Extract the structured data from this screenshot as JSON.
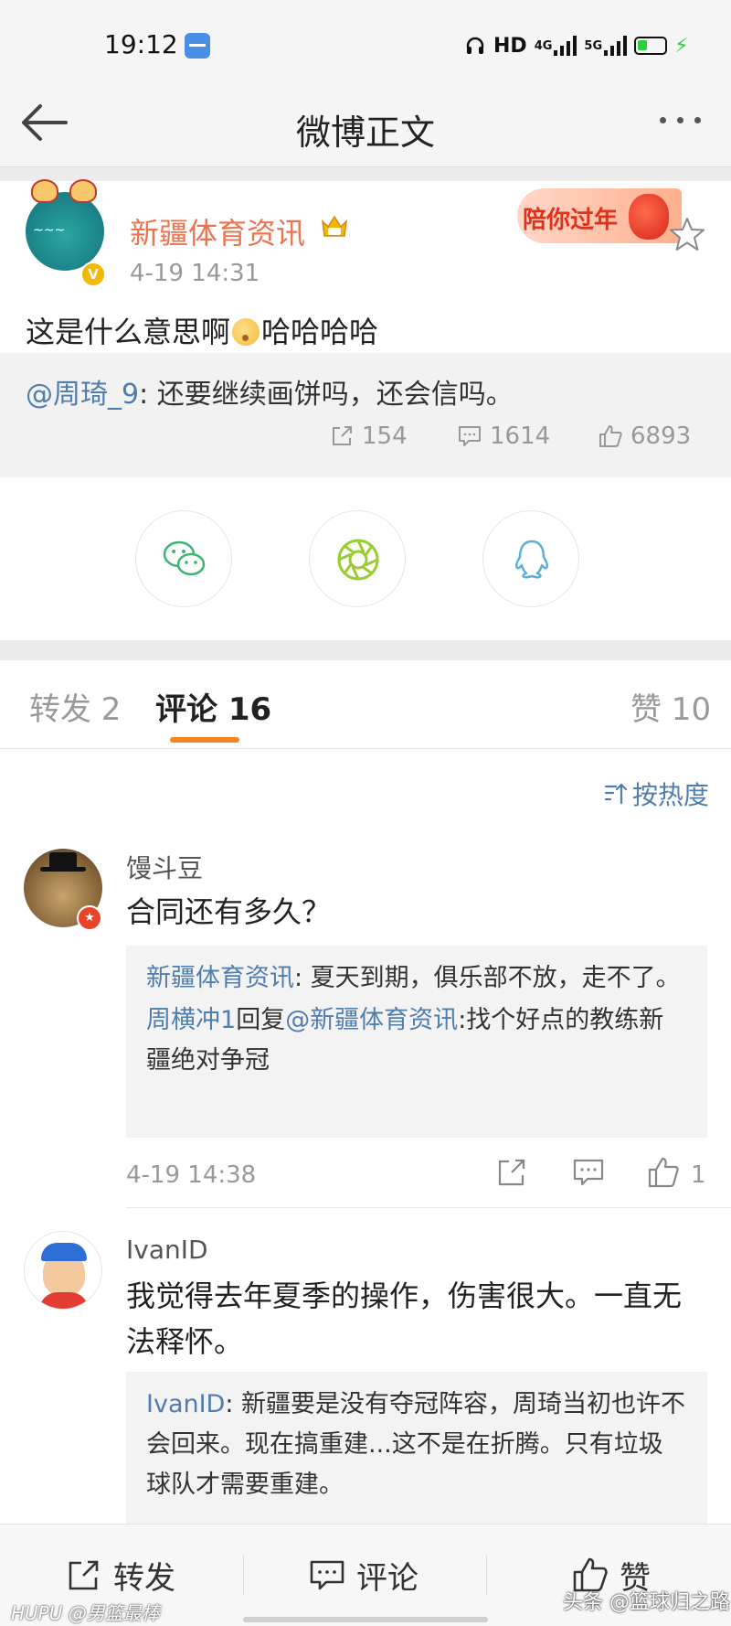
{
  "status_bar": {
    "time": "19:12",
    "hd": "HD",
    "net1": "4G",
    "net2": "5G"
  },
  "nav": {
    "title": "微博正文"
  },
  "post": {
    "author": "新疆体育资讯",
    "time": "4-19 14:31",
    "festival_badge": "陪你过年",
    "text_before_emoji": "这是什么意思啊",
    "text_after_emoji": "哈哈哈哈",
    "repost": {
      "mention": "@周琦_9",
      "text": ": 还要继续画饼吗，还会信吗。"
    },
    "stats": {
      "reposts": "154",
      "comments": "1614",
      "likes": "6893"
    }
  },
  "tabs": {
    "repost": "转发 2",
    "comment": "评论 16",
    "like": "赞 10"
  },
  "sort_label": "按热度",
  "comments": [
    {
      "name": "馒斗豆",
      "text": "合同还有多久？",
      "replies": [
        {
          "author": "新疆体育资讯",
          "text": ": 夏天到期，俱乐部不放，走不了。"
        },
        {
          "author": "周横冲1",
          "mid": "回复",
          "mention": "@新疆体育资讯",
          "text": ":找个好点的教练新疆绝对争冠"
        }
      ],
      "time": "4-19 14:38",
      "likes": "1"
    },
    {
      "name": "IvanID",
      "text": "我觉得去年夏季的操作，伤害很大。一直无法释怀。",
      "replies": [
        {
          "author": "IvanID",
          "text": ": 新疆要是没有夺冠阵容，周琦当初也许不会回来。现在搞重建...这不是在折腾。只有垃圾球队才需要重建。"
        }
      ]
    }
  ],
  "bottom_bar": {
    "repost": "转发",
    "comment": "评论",
    "like": "赞"
  },
  "watermarks": {
    "left": "HUPU @男篮最棒",
    "right": "头条 @篮球归之路"
  },
  "colors": {
    "accent_orange": "#eb7350",
    "link_blue": "#507daf",
    "tab_indicator": "#f7841e"
  }
}
